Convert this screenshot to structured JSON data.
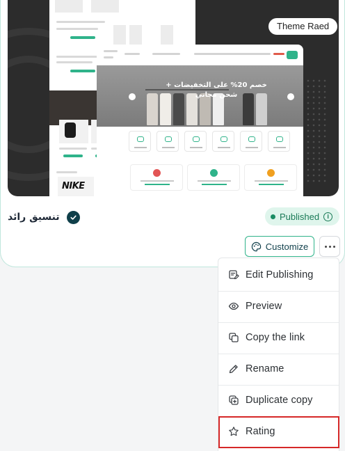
{
  "theme_card": {
    "preview": {
      "badge_label": "Theme Raed",
      "hero_text": "خصم 20% على التخفيضات + شحن مجاني",
      "brand_logo_text": "NIKE"
    },
    "store_name": "تنسيق رائد",
    "status": {
      "label": "Published",
      "color": "#1a7a57"
    },
    "customize_label": "Customize",
    "accent_color": "#2fb38a"
  },
  "menu": {
    "items": [
      {
        "label": "Edit Publishing",
        "icon": "edit-publishing-icon"
      },
      {
        "label": "Preview",
        "icon": "eye-icon"
      },
      {
        "label": "Copy the link",
        "icon": "copy-icon"
      },
      {
        "label": "Rename",
        "icon": "pencil-icon"
      },
      {
        "label": "Duplicate copy",
        "icon": "duplicate-icon"
      },
      {
        "label": "Rating",
        "icon": "star-icon"
      }
    ],
    "highlighted_item": "Rating",
    "highlight_color": "#d62828"
  }
}
